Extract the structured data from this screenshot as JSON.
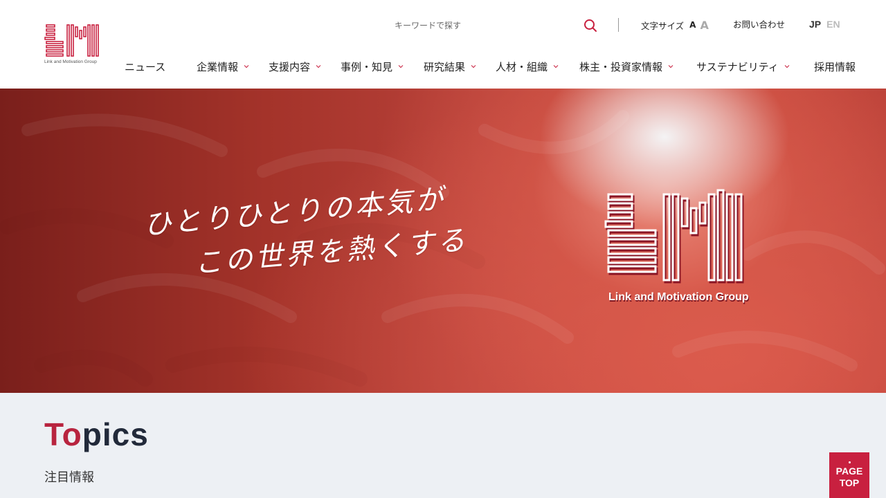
{
  "brand": {
    "logo_caption": "Link and Motivation Group",
    "accent_color": "#c8203f"
  },
  "header": {
    "search": {
      "placeholder": "キーワードで探す",
      "icon": "search-icon"
    },
    "font_size": {
      "label": "文字サイズ",
      "small": "A",
      "large": "A"
    },
    "contact_label": "お問い合わせ",
    "lang": {
      "jp": "JP",
      "en": "EN"
    }
  },
  "nav": {
    "items": [
      {
        "label": "ニュース",
        "dropdown": false
      },
      {
        "label": "企業情報",
        "dropdown": true
      },
      {
        "label": "支援内容",
        "dropdown": true
      },
      {
        "label": "事例・知見",
        "dropdown": true
      },
      {
        "label": "研究結果",
        "dropdown": true
      },
      {
        "label": "人材・組織",
        "dropdown": true
      },
      {
        "label": "株主・投資家情報",
        "dropdown": true
      },
      {
        "label": "サステナビリティ",
        "dropdown": true
      },
      {
        "label": "採用情報",
        "dropdown": false
      }
    ]
  },
  "hero": {
    "slogan_line1": "ひとりひとりの本気が",
    "slogan_line2": "この世界を熱くする",
    "logo_caption": "Link and Motivation Group"
  },
  "topics": {
    "title_accent": "To",
    "title_rest": "pics",
    "subtitle": "注目情報"
  },
  "page_top": {
    "line1": "PAGE",
    "line2": "TOP"
  }
}
